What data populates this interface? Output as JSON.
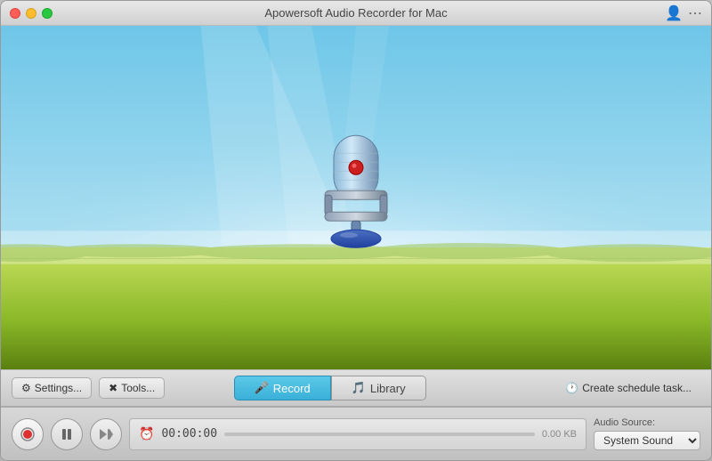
{
  "window": {
    "title": "Apowersoft Audio Recorder for Mac"
  },
  "toolbar": {
    "settings_label": "Settings...",
    "tools_label": "Tools...",
    "record_tab_label": "Record",
    "library_tab_label": "Library",
    "schedule_label": "Create schedule task..."
  },
  "controls": {
    "timer": "00:00:00",
    "file_size": "0.00 KB"
  },
  "audio_source": {
    "label": "Audio Source:",
    "value": "System Sound"
  },
  "colors": {
    "tab_active_bg": "#3ab0d8",
    "tab_inactive_bg": "#d0d0d0"
  }
}
